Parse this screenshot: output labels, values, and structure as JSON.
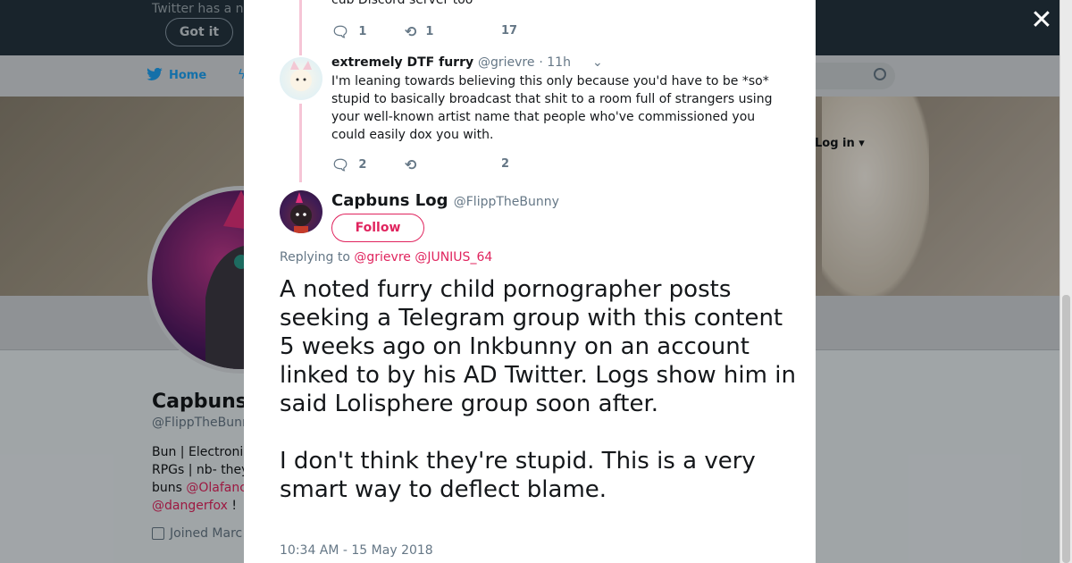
{
  "background": {
    "notice": {
      "text": "Twitter has a n",
      "button": "Got it"
    },
    "nav": {
      "home": "Home",
      "login": "Log in"
    },
    "profile": {
      "name": "Capbuns",
      "handle": "@FlippTheBunn",
      "bio_lines": [
        "Bun | Electroni",
        "RPGs | nb- they",
        "buns "
      ],
      "mention_1": "@Olafanc",
      "mention_2": "@dangerfox",
      "bio_tail": " !",
      "joined": "Joined Marc"
    }
  },
  "modal": {
    "prev_tweet": {
      "text": "cub Discord server too",
      "replies": "1",
      "retweets": "1",
      "likes": "17"
    },
    "reply_tweet": {
      "name": "extremely DTF furry",
      "handle": "@grievre",
      "time": "· 11h",
      "text": "I'm leaning towards believing this only because you'd have to be *so* stupid to basically broadcast that shit to a room full of strangers using your well-known artist name that people who've commissioned you could easily dox you with.",
      "replies": "2",
      "retweets": "",
      "likes": "2"
    },
    "main_tweet": {
      "name": "Capbuns Log",
      "handle": "@FlippTheBunny",
      "follow_label": "Follow",
      "replying_prefix": "Replying to ",
      "replying_mentions": "@grievre @JUNIUS_64",
      "text": "A noted furry child pornographer posts seeking a Telegram group with this content 5 weeks ago on Inkbunny on an account linked to by his AD Twitter. Logs show him in said Lolisphere group soon after.\n\nI don't think they're stupid. This is a very smart way to deflect blame.",
      "timestamp": "10:34 AM - 15 May 2018"
    }
  },
  "close_label": "✕",
  "colors": {
    "accent": "#e0245e",
    "twitter_blue": "#1da1f2",
    "thread_line": "#f6c5d6",
    "muted": "#657786"
  }
}
